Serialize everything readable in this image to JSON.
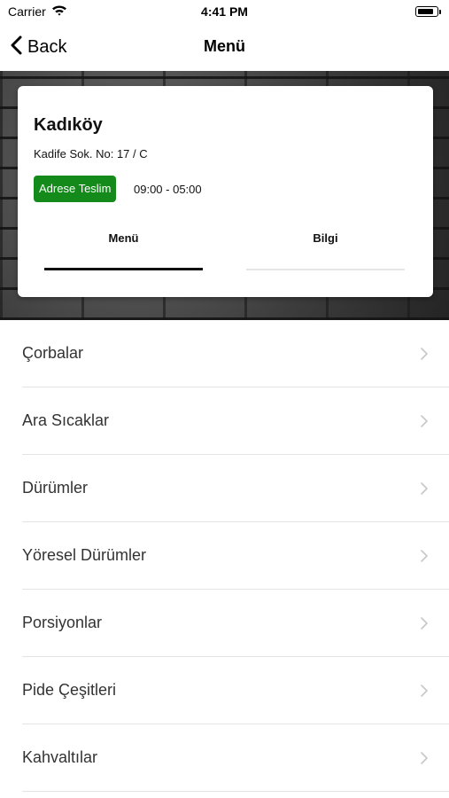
{
  "status_bar": {
    "carrier": "Carrier",
    "time": "4:41 PM",
    "battery_level": 0.85
  },
  "nav": {
    "back_label": "Back",
    "title": "Menü"
  },
  "store": {
    "name": "Kadıköy",
    "address": "Kadife Sok. No: 17 / C",
    "delivery_badge": "Adrese Teslim",
    "hours": "09:00 - 05:00",
    "badge_color": "#138a1a"
  },
  "tabs": [
    {
      "label": "Menü",
      "selected": true
    },
    {
      "label": "Bilgi",
      "selected": false
    }
  ],
  "categories": [
    {
      "label": "Çorbalar"
    },
    {
      "label": "Ara Sıcaklar"
    },
    {
      "label": "Dürümler"
    },
    {
      "label": "Yöresel Dürümler"
    },
    {
      "label": "Porsiyonlar"
    },
    {
      "label": "Pide Çeşitleri"
    },
    {
      "label": "Kahvaltılar"
    }
  ]
}
